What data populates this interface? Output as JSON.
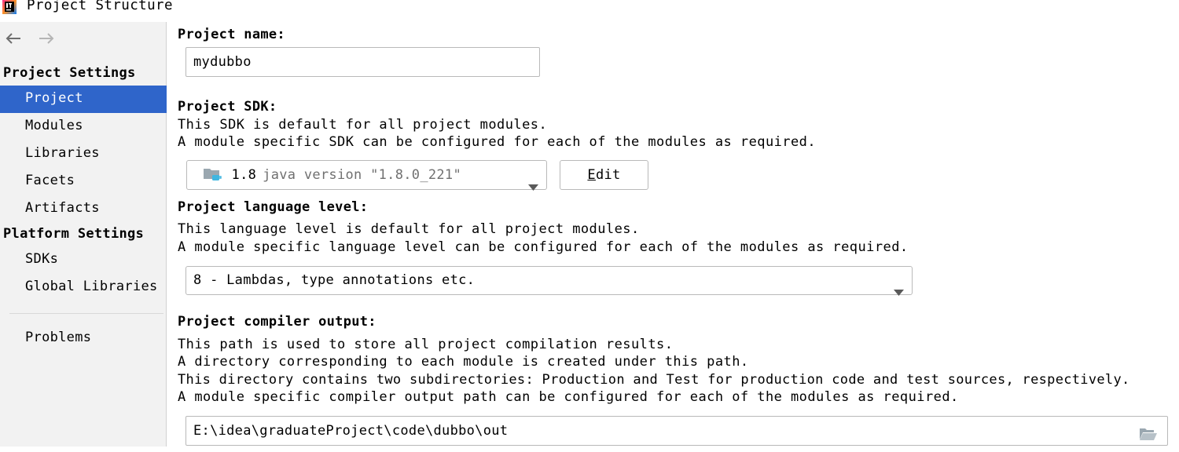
{
  "window": {
    "title": "Project Structure",
    "logo_icon": "intellij-logo-icon"
  },
  "sidebar": {
    "nav": {
      "back_icon": "arrow-left-icon",
      "forward_icon": "arrow-right-icon"
    },
    "project_settings_header": "Project Settings",
    "project_settings_items": [
      {
        "label": "Project",
        "selected": true
      },
      {
        "label": "Modules"
      },
      {
        "label": "Libraries"
      },
      {
        "label": "Facets"
      },
      {
        "label": "Artifacts"
      }
    ],
    "platform_settings_header": "Platform Settings",
    "platform_settings_items": [
      {
        "label": "SDKs"
      },
      {
        "label": "Global Libraries"
      }
    ],
    "problems_label": "Problems",
    "selected_color": "#2f65ca"
  },
  "main": {
    "project_name": {
      "label": "Project name:",
      "value": "mydubbo"
    },
    "project_sdk": {
      "label": "Project SDK:",
      "desc_line1": "This SDK is default for all project modules.",
      "desc_line2": "A module specific SDK can be configured for each of the modules as required.",
      "selected_version": "1.8",
      "selected_detail": "java version \"1.8.0_221\"",
      "sdk_icon": "jdk-folder-icon",
      "edit_button": "Edit"
    },
    "language_level": {
      "label": "Project language level:",
      "desc_line1": "This language level is default for all project modules.",
      "desc_line2": "A module specific language level can be configured for each of the modules as required.",
      "selected": "8 - Lambdas, type annotations etc."
    },
    "compiler_output": {
      "label": "Project compiler output:",
      "desc_line1": "This path is used to store all project compilation results.",
      "desc_line2": "A directory corresponding to each module is created under this path.",
      "desc_line3": "This directory contains two subdirectories: Production and Test for production code and test sources, respectively.",
      "desc_line4": "A module specific compiler output path can be configured for each of the modules as required.",
      "path": "E:\\idea\\graduateProject\\code\\dubbo\\out",
      "browse_icon": "folder-open-icon"
    }
  }
}
